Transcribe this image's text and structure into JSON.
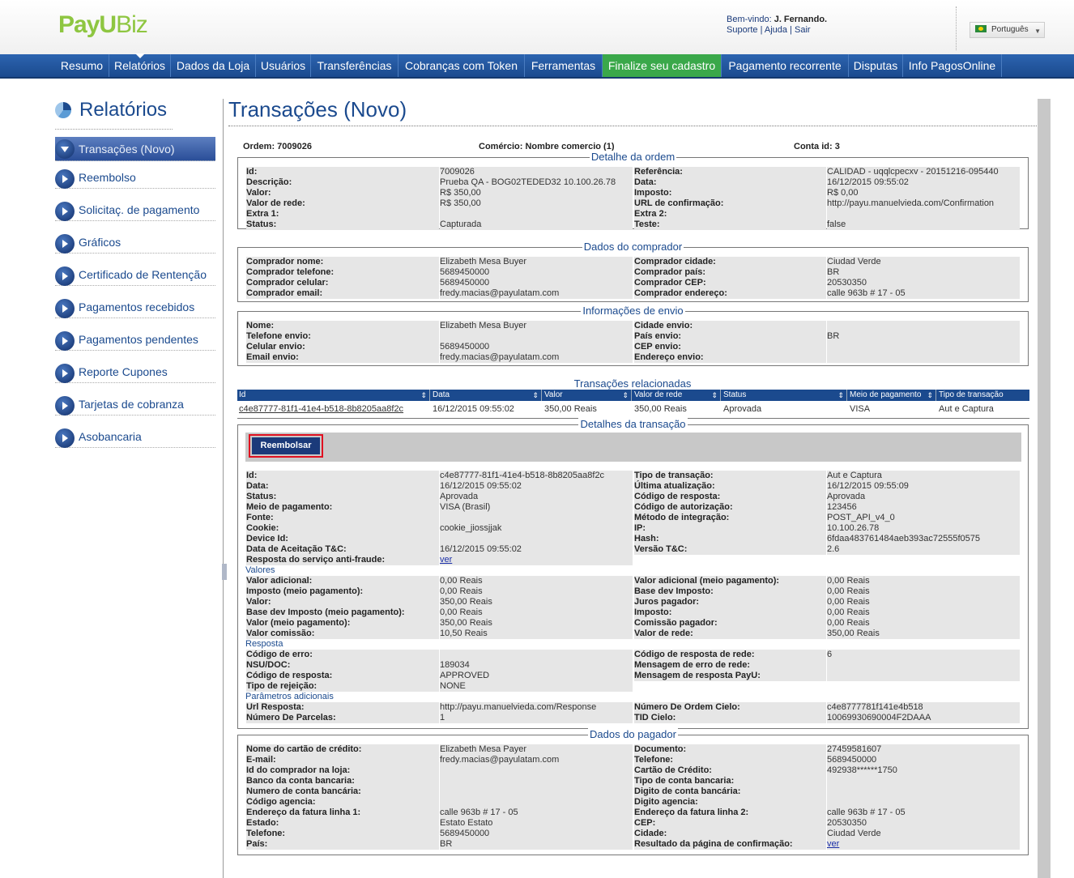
{
  "header": {
    "logo": {
      "pay": "Pay",
      "u": "U",
      "biz": "Biz"
    },
    "welcome_prefix": "Bem-vindo:",
    "user": "J. Fernando.",
    "links": [
      "Suporte",
      "Ajuda",
      "Sair"
    ],
    "language": "Português"
  },
  "nav": {
    "items": [
      "Resumo",
      "Relatórios",
      "Dados da Loja",
      "Usuários",
      "Transferências",
      "Cobranças com Token",
      "Ferramentas",
      "Finalize seu cadastro",
      "Pagamento recorrente",
      "Disputas",
      "Info PagosOnline"
    ],
    "highlight_color": "#3aa84a",
    "bar_color": "#1b4a8e"
  },
  "sidebar": {
    "title": "Relatórios",
    "items": [
      "Transações (Novo)",
      "Reembolso",
      "Solicitaç. de pagamento",
      "Gráficos",
      "Certificado de Rentenção",
      "Pagamentos recebidos",
      "Pagamentos pendentes",
      "Reporte Cupones",
      "Tarjetas de cobranza",
      "Asobancaria"
    ],
    "active_index": 0
  },
  "main": {
    "title": "Transações (Novo)",
    "ordem": "Ordem: 7009026",
    "comercio": "Comércio: Nombre comercio (1)",
    "conta": "Conta id: 3",
    "order_detail": {
      "legend": "Detalhe da ordem",
      "rows": [
        [
          "Id:",
          "7009026",
          "Referência:",
          "CALIDAD - uqqlcpecxv - 20151216-095440"
        ],
        [
          "Descrição:",
          "Prueba QA - BOG02TEDED32 10.100.26.78",
          "Data:",
          "16/12/2015 09:55:02"
        ],
        [
          "Valor:",
          "R$ 350,00",
          "Imposto:",
          "R$ 0,00"
        ],
        [
          "Valor de rede:",
          "R$ 350,00",
          "URL de confirmação:",
          "http://payu.manuelvieda.com/Confirmation"
        ],
        [
          "Extra 1:",
          "",
          "Extra 2:",
          ""
        ],
        [
          "Status:",
          "Capturada",
          "Teste:",
          "false"
        ]
      ]
    },
    "buyer": {
      "legend": "Dados do comprador",
      "rows": [
        [
          "Comprador nome:",
          "Elizabeth Mesa Buyer",
          "Comprador cidade:",
          "Ciudad Verde"
        ],
        [
          "Comprador telefone:",
          "5689450000",
          "Comprador país:",
          "BR"
        ],
        [
          "Comprador celular:",
          "5689450000",
          "Comprador CEP:",
          "20530350"
        ],
        [
          "Comprador email:",
          "fredy.macias@payulatam.com",
          "Comprador endereço:",
          "calle 963b # 17 - 05"
        ]
      ]
    },
    "shipping": {
      "legend": "Informações de envio",
      "rows": [
        [
          "Nome:",
          "Elizabeth Mesa Buyer",
          "Cidade envio:",
          ""
        ],
        [
          "Telefone envio:",
          "",
          "País envio:",
          "BR"
        ],
        [
          "Celular envio:",
          "5689450000",
          "CEP envio:",
          ""
        ],
        [
          "Email envio:",
          "fredy.macias@payulatam.com",
          "Endereço envio:",
          ""
        ]
      ]
    },
    "related": {
      "title": "Transações relacionadas",
      "columns": [
        "Id",
        "Data",
        "Valor",
        "Valor de rede",
        "Status",
        "Meio de pagamento",
        "Tipo de transação"
      ],
      "row": [
        "c4e87777-81f1-41e4-b518-8b8205aa8f2c",
        "16/12/2015 09:55:02",
        "350,00 Reais",
        "350,00 Reais",
        "Aprovada",
        "VISA",
        "Aut e Captura"
      ]
    },
    "tx": {
      "legend": "Detalhes da transação",
      "refund_button": "Reembolsar",
      "rows": [
        [
          "Id:",
          "c4e87777-81f1-41e4-b518-8b8205aa8f2c",
          "Tipo de transação:",
          "Aut e Captura"
        ],
        [
          "Data:",
          "16/12/2015 09:55:02",
          "Última atualização:",
          "16/12/2015 09:55:09"
        ],
        [
          "Status:",
          "Aprovada",
          "Código de resposta:",
          "Aprovada"
        ],
        [
          "Meio de pagamento:",
          "VISA (Brasil)",
          "Código de autorização:",
          "123456"
        ],
        [
          "Fonte:",
          "",
          "Método de integração:",
          "POST_API_v4_0"
        ],
        [
          "Cookie:",
          "cookie_jiossjjak",
          "IP:",
          "10.100.26.78"
        ],
        [
          "Device Id:",
          "",
          "Hash:",
          "6fdaa483761484aeb393ac72555f0575"
        ],
        [
          "Data de Aceitação T&C:",
          "16/12/2015 09:55:02",
          "Versão T&C:",
          "2.6"
        ]
      ],
      "antifraud_label": "Resposta do serviço anti-fraude:",
      "antifraud_link": "ver",
      "valores_title": "Valores",
      "valores": [
        [
          "Valor adicional:",
          "0,00 Reais",
          "Valor adicional (meio pagamento):",
          "0,00 Reais"
        ],
        [
          "Imposto (meio pagamento):",
          "0,00 Reais",
          "Base dev Imposto:",
          "0,00 Reais"
        ],
        [
          "Valor:",
          "350,00 Reais",
          "Juros pagador:",
          "0,00 Reais"
        ],
        [
          "Base dev Imposto (meio pagamento):",
          "0,00 Reais",
          "Imposto:",
          "0,00 Reais"
        ],
        [
          "Valor (meio pagamento):",
          "350,00 Reais",
          "Comissão pagador:",
          "0,00 Reais"
        ],
        [
          "Valor comissão:",
          "10,50 Reais",
          "Valor de rede:",
          "350,00 Reais"
        ]
      ],
      "resposta_title": "Resposta",
      "resposta": [
        [
          "Código de erro:",
          "",
          "Código de resposta de rede:",
          "6"
        ],
        [
          "NSU/DOC:",
          "189034",
          "Mensagem de erro de rede:",
          ""
        ],
        [
          "Código de resposta:",
          "APPROVED",
          "Mensagem de resposta PayU:",
          ""
        ]
      ],
      "rejeicao_label": "Tipo de rejeição:",
      "rejeicao_value": "NONE",
      "params_title": "Parâmetros adicionais",
      "params": [
        [
          "Url Resposta:",
          "http://payu.manuelvieda.com/Response",
          "Número De Ordem Cielo:",
          "c4e8777781f141e4b518"
        ],
        [
          "Número De Parcelas:",
          "1",
          "TID Cielo:",
          "10069930690004F2DAAA"
        ]
      ]
    },
    "payer": {
      "legend": "Dados do pagador",
      "rows": [
        [
          "Nome do cartão de crédito:",
          "Elizabeth Mesa Payer",
          "Documento:",
          "27459581607"
        ],
        [
          "E-mail:",
          "fredy.macias@payulatam.com",
          "Telefone:",
          "5689450000"
        ],
        [
          "Id do comprador na loja:",
          "",
          "Cartão de Crédito:",
          "492938******1750"
        ],
        [
          "Banco da conta bancaria:",
          "",
          "Tipo de conta bancaria:",
          ""
        ],
        [
          "Numero de conta bancária:",
          "",
          "Digito de conta bancária:",
          ""
        ],
        [
          "Código agencia:",
          "",
          "Digito agencia:",
          ""
        ],
        [
          "Endereço da fatura linha 1:",
          "calle 963b # 17 - 05",
          "Endereço da fatura linha 2:",
          "calle 963b # 17 - 05"
        ],
        [
          "Estado:",
          "Estato Estato",
          "CEP:",
          "20530350"
        ],
        [
          "Telefone:",
          "5689450000",
          "Cidade:",
          "Ciudad Verde"
        ],
        [
          "País:",
          "BR",
          "Resultado da página de confirmação:",
          "ver"
        ]
      ]
    }
  }
}
